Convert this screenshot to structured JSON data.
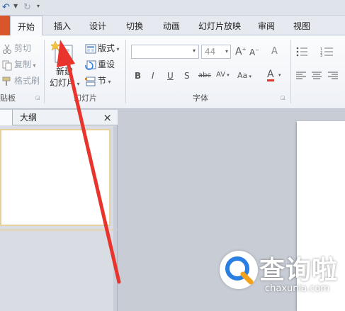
{
  "ribbon_tabs": {
    "home": "开始",
    "insert": "插入",
    "design": "设计",
    "transitions": "切换",
    "animations": "动画",
    "slideshow": "幻灯片放映",
    "review": "审阅",
    "view": "视图"
  },
  "clipboard": {
    "cut": "剪切",
    "copy": "复制",
    "format_painter": "格式刷",
    "group": "贴板"
  },
  "slides_group": {
    "new_slide_1": "新建",
    "new_slide_2": "幻灯片",
    "layout": "版式",
    "reset": "重设",
    "section": "节",
    "group": "幻灯片"
  },
  "font_group": {
    "size": "44",
    "grow": "A",
    "shrink": "A",
    "clear": "A",
    "bold": "B",
    "italic": "I",
    "underline": "U",
    "shadow": "S",
    "strike": "abc",
    "spacing": "AV",
    "case": "Aa",
    "color": "A",
    "group": "字体"
  },
  "panel": {
    "outline_tab": "大纲",
    "close": "×"
  },
  "watermark": {
    "title": "查询啦",
    "url": "chaxunla.com"
  },
  "colors": {
    "accent_orange": "#d8562a",
    "arrow_red": "#e8342c",
    "logo_blue": "#2a7de1"
  }
}
